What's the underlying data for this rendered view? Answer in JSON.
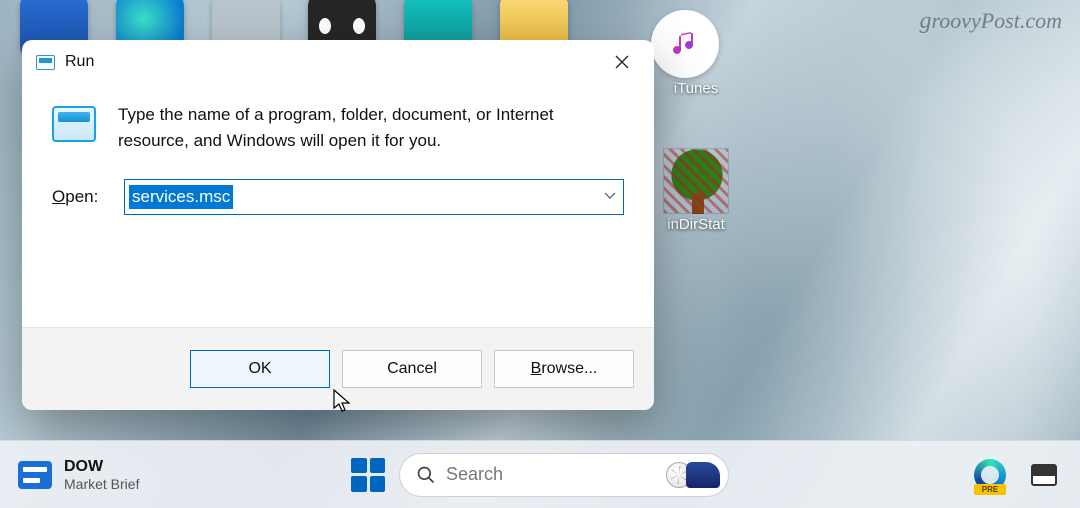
{
  "watermark": "groovyPost.com",
  "desktop": {
    "icons": {
      "itunes": "iTunes",
      "windirstat": "inDirStat"
    }
  },
  "run": {
    "title": "Run",
    "description": "Type the name of a program, folder, document, or Internet resource, and Windows will open it for you.",
    "open_label_pre": "O",
    "open_label_post": "pen:",
    "input_value": "services.msc",
    "buttons": {
      "ok": "OK",
      "cancel": "Cancel",
      "browse_u": "B",
      "browse_post": "rowse..."
    }
  },
  "taskbar": {
    "widget_title": "DOW",
    "widget_sub": "Market Brief",
    "search_placeholder": "Search",
    "edge_badge": "PRE"
  }
}
